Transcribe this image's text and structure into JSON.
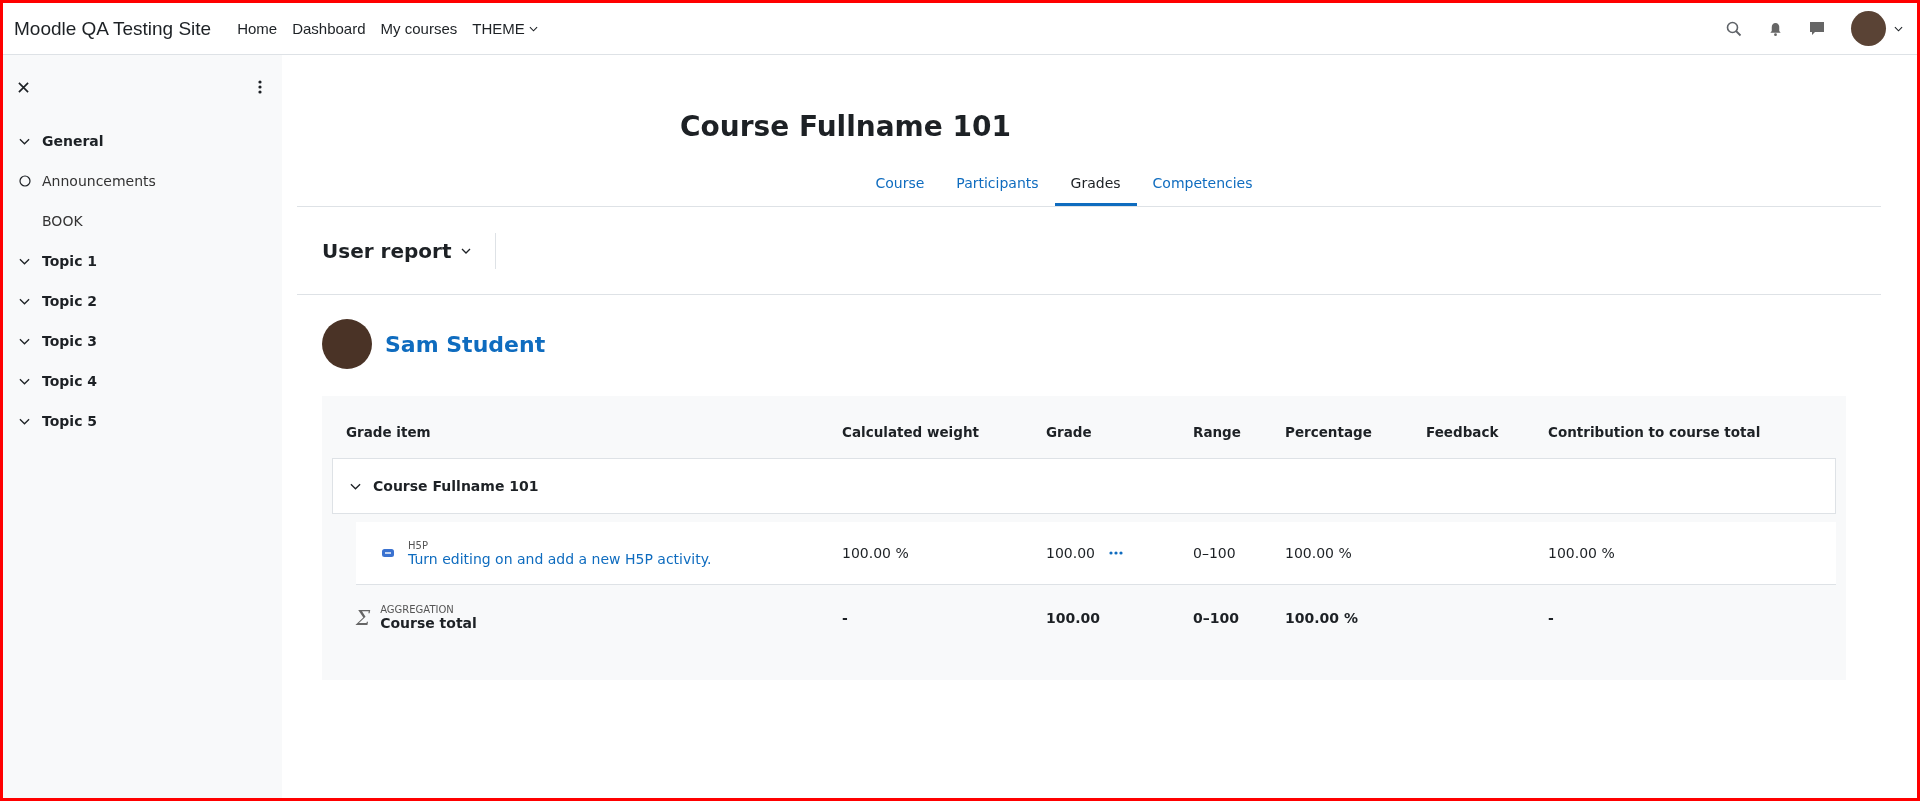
{
  "navbar": {
    "brand": "Moodle QA Testing Site",
    "links": [
      {
        "label": "Home",
        "dropdown": false
      },
      {
        "label": "Dashboard",
        "dropdown": false
      },
      {
        "label": "My courses",
        "dropdown": false
      },
      {
        "label": "THEME",
        "dropdown": true
      }
    ]
  },
  "course_index": {
    "sections": [
      {
        "title": "General",
        "expanded": true,
        "children": [
          {
            "title": "Announcements",
            "kind": "activity"
          },
          {
            "title": "BOOK",
            "kind": "label"
          }
        ]
      },
      {
        "title": "Topic 1",
        "expanded": true
      },
      {
        "title": "Topic 2",
        "expanded": true
      },
      {
        "title": "Topic 3",
        "expanded": true
      },
      {
        "title": "Topic 4",
        "expanded": true
      },
      {
        "title": "Topic 5",
        "expanded": true
      }
    ]
  },
  "page": {
    "title": "Course Fullname 101",
    "tabs": [
      {
        "label": "Course",
        "selected": false
      },
      {
        "label": "Participants",
        "selected": false
      },
      {
        "label": "Grades",
        "selected": true
      },
      {
        "label": "Competencies",
        "selected": false
      }
    ],
    "report_selector": "User report",
    "user": {
      "name": "Sam Student"
    }
  },
  "table": {
    "columns": [
      "Grade item",
      "Calculated weight",
      "Grade",
      "Range",
      "Percentage",
      "Feedback",
      "Contribution to course total"
    ],
    "rows": [
      {
        "kind": "category",
        "expanded": true,
        "name": "Course Fullname 101"
      },
      {
        "kind": "item",
        "type": "H5P",
        "name": "Turn editing on and add a new H5P activity.",
        "weight": "100.00 %",
        "grade": "100.00",
        "range": "0–100",
        "percentage": "100.00 %",
        "contribution": "100.00 %"
      },
      {
        "kind": "total",
        "icon": "Σ",
        "type": "AGGREGATION",
        "name": "Course total",
        "weight": "-",
        "grade": "100.00",
        "range": "0–100",
        "percentage": "100.00 %",
        "contribution": "-"
      }
    ]
  }
}
